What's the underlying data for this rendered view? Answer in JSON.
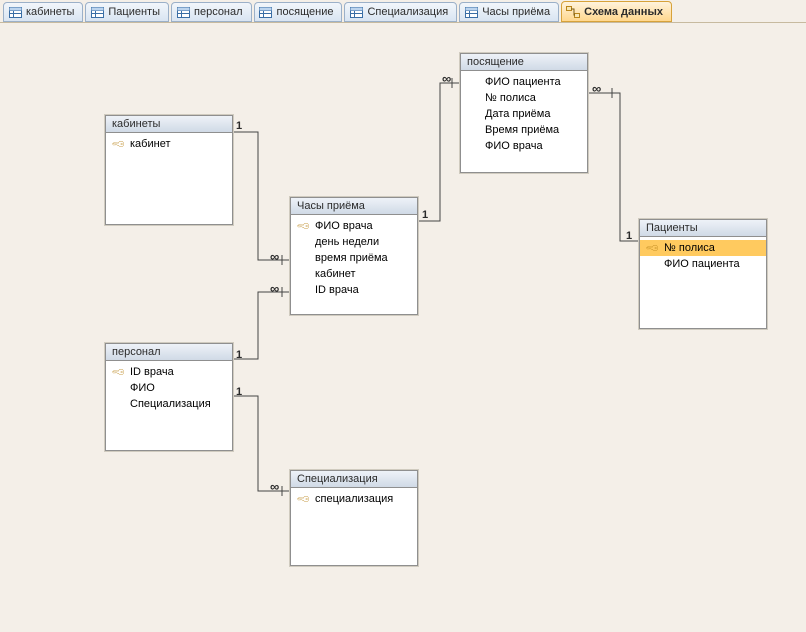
{
  "tabs": [
    {
      "label": "кабинеты",
      "active": false,
      "icon": "table"
    },
    {
      "label": "Пациенты",
      "active": false,
      "icon": "table"
    },
    {
      "label": "персонал",
      "active": false,
      "icon": "table"
    },
    {
      "label": "посящение",
      "active": false,
      "icon": "table"
    },
    {
      "label": "Специализация",
      "active": false,
      "icon": "table"
    },
    {
      "label": "Часы приёма",
      "active": false,
      "icon": "table"
    },
    {
      "label": "Схема данных",
      "active": true,
      "icon": "relationships"
    }
  ],
  "tables": {
    "kabinety": {
      "title": "кабинеты",
      "fields": [
        {
          "name": "кабинет",
          "pk": true
        }
      ]
    },
    "chasy": {
      "title": "Часы приёма",
      "fields": [
        {
          "name": "ФИО врача",
          "pk": true
        },
        {
          "name": "день недели",
          "pk": false
        },
        {
          "name": "время приёма",
          "pk": false
        },
        {
          "name": "кабинет",
          "pk": false
        },
        {
          "name": "ID врача",
          "pk": false
        }
      ]
    },
    "posyash": {
      "title": "посящение",
      "fields": [
        {
          "name": "ФИО пациента",
          "pk": false
        },
        {
          "name": "№ полиса",
          "pk": false
        },
        {
          "name": "Дата приёма",
          "pk": false
        },
        {
          "name": "Время приёма",
          "pk": false
        },
        {
          "name": "ФИО врача",
          "pk": false
        }
      ]
    },
    "personal": {
      "title": "персонал",
      "fields": [
        {
          "name": "ID врача",
          "pk": true
        },
        {
          "name": "ФИО",
          "pk": false
        },
        {
          "name": "Специализация",
          "pk": false
        }
      ]
    },
    "special": {
      "title": "Специализация",
      "fields": [
        {
          "name": "специализация",
          "pk": true
        }
      ]
    },
    "pacienty": {
      "title": "Пациенты",
      "fields": [
        {
          "name": "№ полиса",
          "pk": true,
          "selected": true
        },
        {
          "name": "ФИО пациента",
          "pk": false
        }
      ]
    }
  },
  "cardinality": {
    "one": "1",
    "many": "∞"
  }
}
